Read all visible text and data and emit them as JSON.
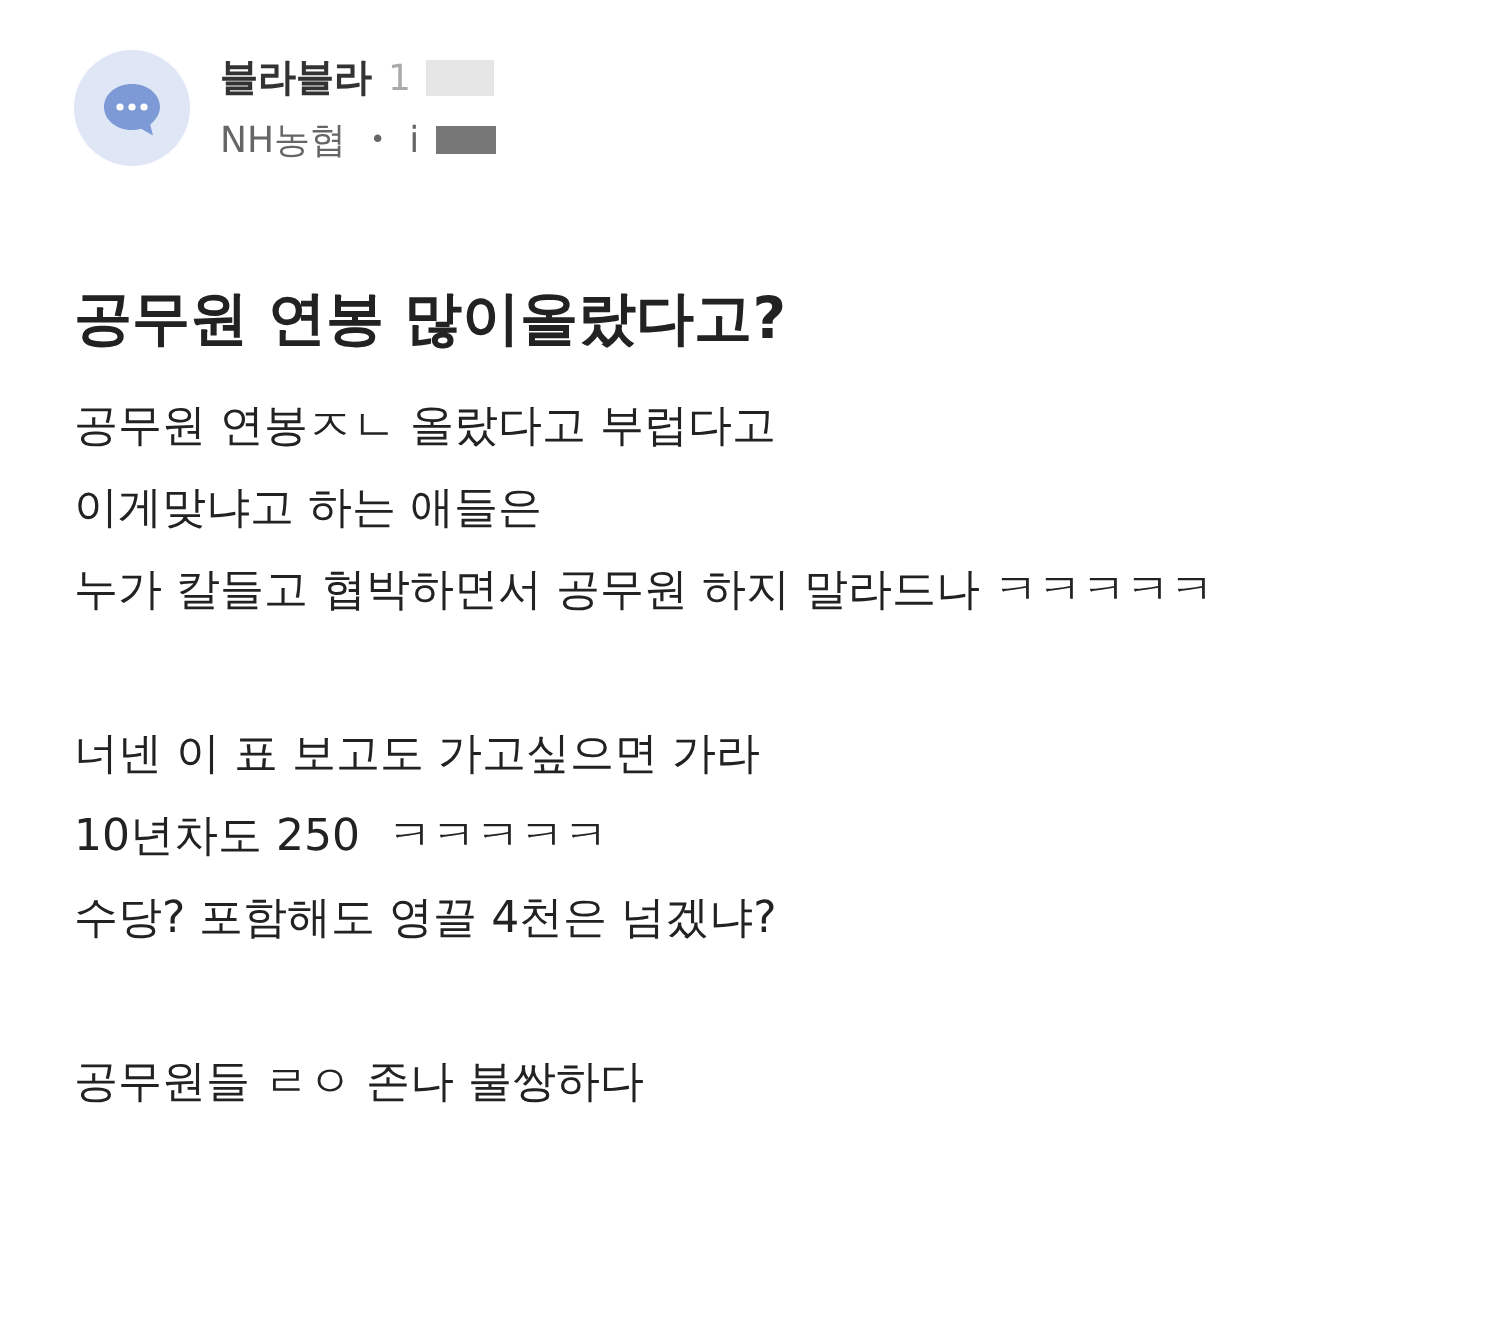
{
  "author": {
    "name": "블라블라",
    "time": "1",
    "company": "NH농협",
    "separator": "•",
    "extra": "i"
  },
  "post": {
    "title": "공무원 연봉 많이올랐다고?",
    "paragraphs": [
      [
        "공무원 연봉ㅈㄴ 올랐다고 부럽다고",
        "이게맞냐고 하는 애들은",
        "누가 칼들고 협박하면서 공무원 하지 말라드나 ㅋㅋㅋㅋㅋ"
      ],
      [
        "너넨 이 표 보고도 가고싶으면 가라",
        "10년차도 250  ㅋㅋㅋㅋㅋ",
        "수당? 포함해도 영끌 4천은 넘겠냐?"
      ],
      [
        "공무원들 ㄹㅇ 존나 불쌍하다"
      ]
    ]
  }
}
